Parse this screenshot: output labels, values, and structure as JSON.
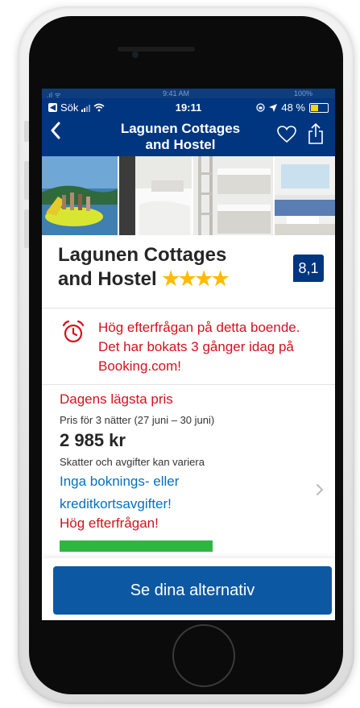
{
  "ghost_status": {
    "carrier": ".ıl ᯤ",
    "time": "9:41 AM",
    "battery": "100%"
  },
  "status": {
    "back_app": "Sök",
    "time": "19:11",
    "battery_percent": "48 %",
    "battery_level": 0.48
  },
  "header": {
    "title_line1": "Lagunen Cottages",
    "title_line2": "and Hostel",
    "back_symbol": "‹"
  },
  "gallery": {
    "photos": [
      "pool-photo",
      "bedroom-photo",
      "bunkbed-photo",
      "living-room-photo"
    ]
  },
  "hotel": {
    "name_line1": "Lagunen Cottages",
    "name_line2": "and Hostel",
    "stars": "★★★★",
    "star_count": 4,
    "score": "8,1"
  },
  "demand": {
    "message": "Hög efterfrågan på detta boende. Det har bokats 3 gånger idag på Booking.com!"
  },
  "price": {
    "lowest_label": "Dagens lägsta pris",
    "nights": "Pris för 3 nätter (27 juni – 30 juni)",
    "amount": "2 985 kr",
    "taxes": "Skatter och avgifter kan variera",
    "no_fees": "Inga boknings- eller kreditkortsavgifter!",
    "high_demand": "Hög efterfrågan!"
  },
  "cta": {
    "label": "Se dina alternativ"
  },
  "colors": {
    "brand": "#003580",
    "cta": "#0d58a3",
    "alert_red": "#d4111e",
    "link_blue": "#0071c2",
    "star_yellow": "#febb02",
    "green": "#2db742"
  }
}
